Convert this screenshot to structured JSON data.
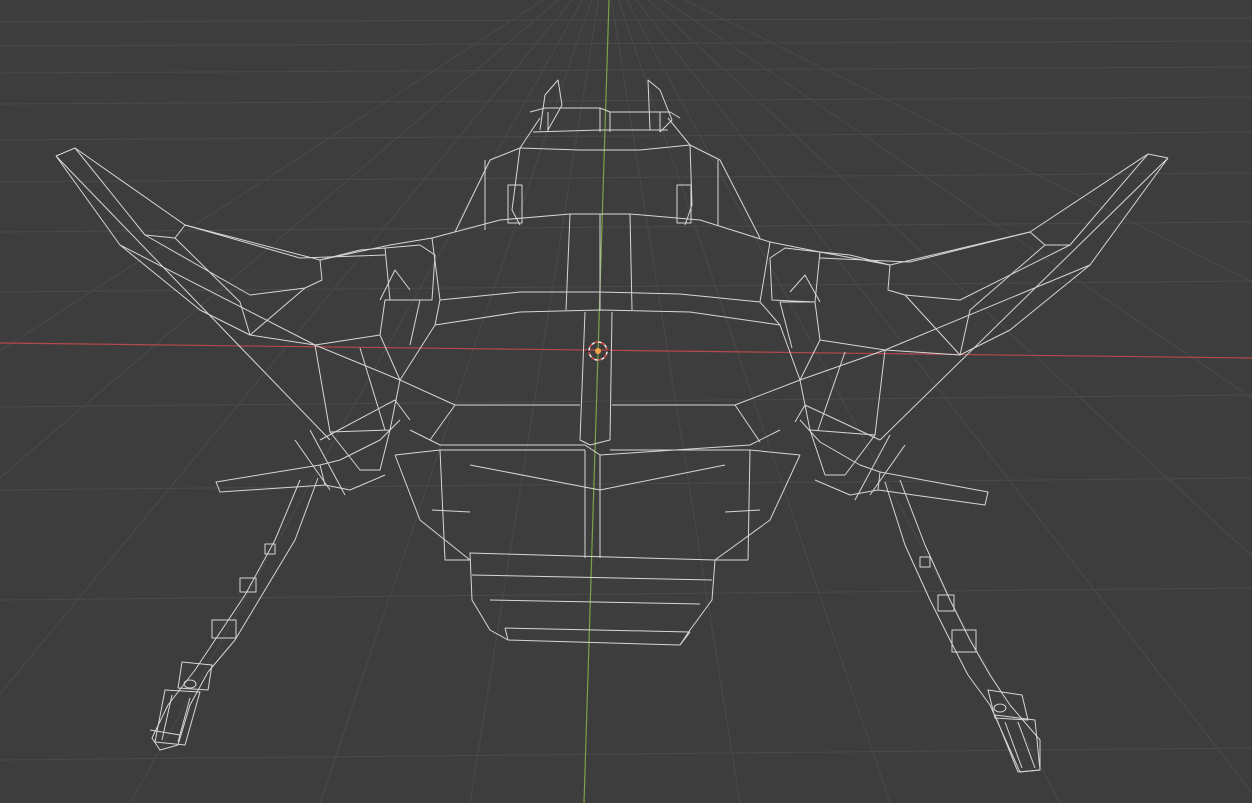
{
  "viewport": {
    "background_color": "#3d3d3d",
    "grid_color": "#4a4a4a",
    "x_axis_color": "#b5484a",
    "y_axis_color": "#7ba34a",
    "wireframe_color": "#d6d6d6",
    "origin_color": "#f2a14a"
  },
  "icons": {
    "object_origin": "origin-cursor-icon"
  }
}
